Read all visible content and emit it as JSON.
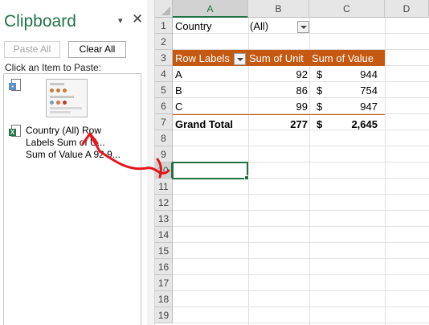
{
  "clipboard": {
    "title": "Clipboard",
    "menu_glyph": "▾",
    "close_glyph": "✕",
    "paste_all_label": "Paste All",
    "clear_all_label": "Clear All",
    "instruction": "Click an Item to Paste:",
    "items": [
      {
        "kind": "image",
        "icon": "picture-clip-icon"
      },
      {
        "kind": "excel",
        "icon": "excel-clip-icon",
        "badge": "X",
        "lines": [
          "Country (All) Row",
          "Labels Sum of U...",
          "Sum of Value A 92 9..."
        ]
      }
    ]
  },
  "sheet": {
    "columns": [
      "A",
      "B",
      "C",
      "D"
    ],
    "active_column": "A",
    "rows": [
      "1",
      "2",
      "3",
      "4",
      "5",
      "6",
      "7",
      "8",
      "9",
      "10",
      "11",
      "12",
      "13",
      "14",
      "15",
      "16",
      "17",
      "18",
      "19"
    ],
    "active_row": "10",
    "filter": {
      "label": "Country",
      "value": "(All)"
    },
    "pivot": {
      "headers": [
        "Row Labels",
        "Sum of Unit",
        "Sum of Value"
      ],
      "currency": "$",
      "rows": [
        {
          "label": "A",
          "unit": "92",
          "value": "944"
        },
        {
          "label": "B",
          "unit": "86",
          "value": "754"
        },
        {
          "label": "C",
          "unit": "99",
          "value": "947"
        }
      ],
      "total": {
        "label": "Grand Total",
        "unit": "277",
        "value": "2,645"
      }
    }
  },
  "colors": {
    "accent": "#217346",
    "pivot_header": "#c65911",
    "annotation": "#e8141c"
  }
}
